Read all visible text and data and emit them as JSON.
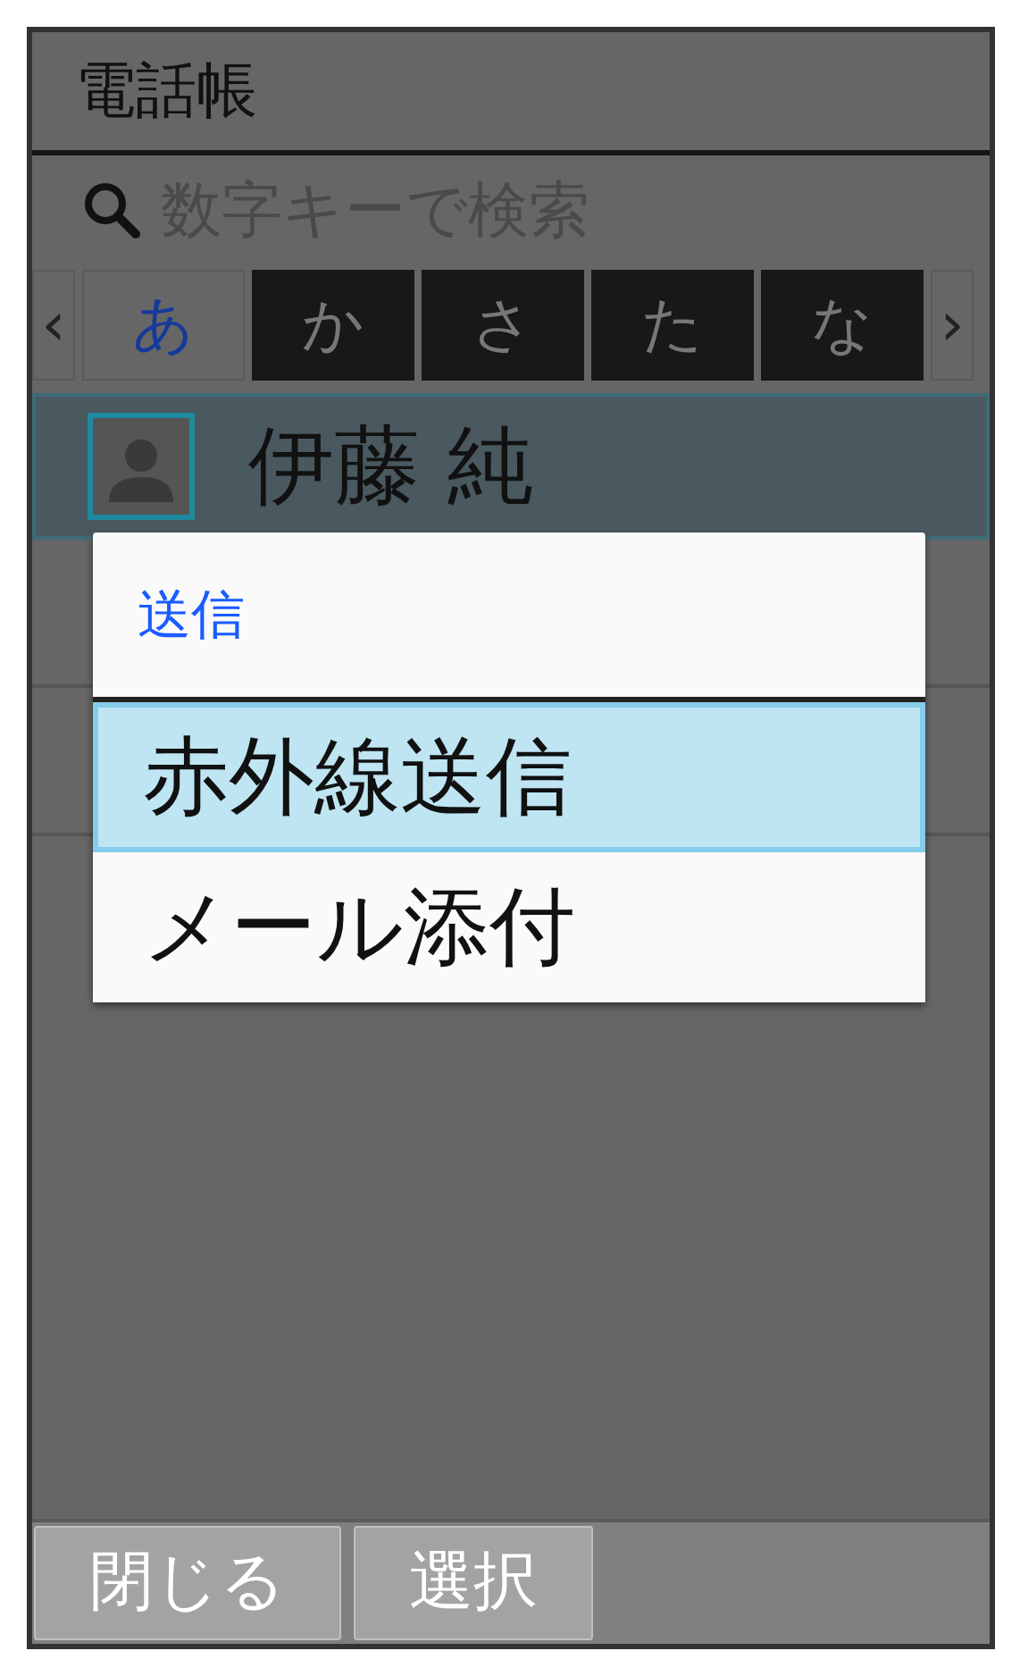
{
  "title": "電話帳",
  "search": {
    "placeholder": "数字キーで検索"
  },
  "index_tabs": {
    "prev": "‹",
    "next": "›",
    "tabs": [
      {
        "label": "あ",
        "selected": true
      },
      {
        "label": "か",
        "selected": false
      },
      {
        "label": "さ",
        "selected": false
      },
      {
        "label": "た",
        "selected": false
      },
      {
        "label": "な",
        "selected": false
      }
    ]
  },
  "contacts": [
    {
      "name": "伊藤 純",
      "selected": true
    }
  ],
  "dialog": {
    "title": "送信",
    "items": [
      {
        "label": "赤外線送信",
        "selected": true
      },
      {
        "label": "メール添付",
        "selected": false
      }
    ]
  },
  "softkeys": [
    "閉じる",
    "選択"
  ]
}
